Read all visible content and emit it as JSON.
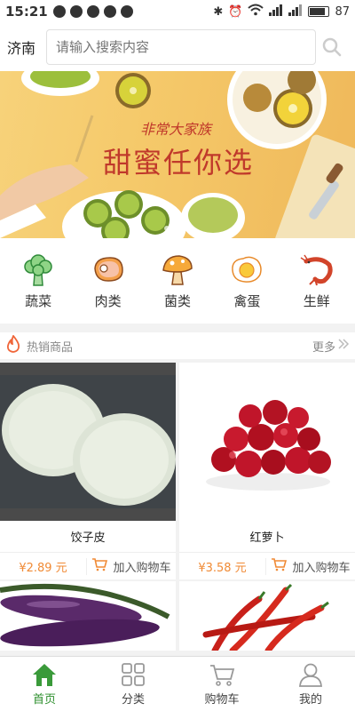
{
  "status_bar": {
    "time": "15:21",
    "battery": "87",
    "battery_level": 0.87
  },
  "header": {
    "city": "济南",
    "search_placeholder": "请输入搜索内容"
  },
  "banner": {
    "subtitle": "非常大家族",
    "title": "甜蜜任你选",
    "slides": 3,
    "active_slide": 1
  },
  "categories": [
    {
      "label": "蔬菜",
      "icon": "broccoli-icon"
    },
    {
      "label": "肉类",
      "icon": "meat-icon"
    },
    {
      "label": "菌类",
      "icon": "mushroom-icon"
    },
    {
      "label": "禽蛋",
      "icon": "egg-icon"
    },
    {
      "label": "生鲜",
      "icon": "shrimp-icon"
    }
  ],
  "hot_section": {
    "title": "热销商品",
    "more_label": "更多"
  },
  "products": [
    {
      "name": "饺子皮",
      "price": "¥2.89 元",
      "add_label": "加入购物车",
      "image": "dumpling-wrapper-photo"
    },
    {
      "name": "红萝卜",
      "price": "¥3.58 元",
      "add_label": "加入购物车",
      "image": "red-radish-photo"
    },
    {
      "name": "",
      "image": "eggplant-photo"
    },
    {
      "name": "",
      "image": "red-chili-photo"
    }
  ],
  "tabbar": [
    {
      "label": "首页",
      "icon": "home-icon",
      "active": true
    },
    {
      "label": "分类",
      "icon": "grid-icon",
      "active": false
    },
    {
      "label": "购物车",
      "icon": "cart-icon",
      "active": false
    },
    {
      "label": "我的",
      "icon": "user-icon",
      "active": false
    }
  ],
  "colors": {
    "accent_green": "#2d8f2d",
    "price_orange": "#f08a35",
    "banner_red": "#c0392b"
  }
}
